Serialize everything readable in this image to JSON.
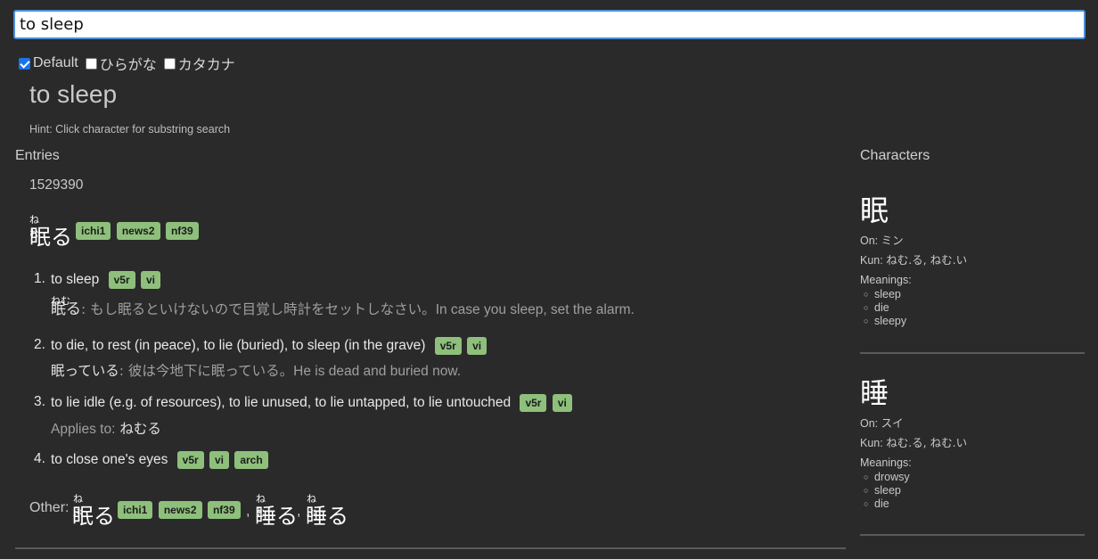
{
  "search": {
    "value": "to sleep"
  },
  "filters": [
    {
      "label": "Default",
      "checked": true
    },
    {
      "label": "ひらがな",
      "checked": false
    },
    {
      "label": "カタカナ",
      "checked": false
    }
  ],
  "query_title": "to sleep",
  "hint": "Hint: Click character for substring search",
  "entries": {
    "heading": "Entries",
    "id": "1529390",
    "headword": {
      "kanji": "眠る",
      "furigana": "ねむ",
      "tags": [
        "ichi1",
        "news2",
        "nf39"
      ]
    },
    "senses": [
      {
        "num": "1.",
        "gloss": "to sleep",
        "tags": [
          "v5r",
          "vi"
        ],
        "example": {
          "word": "眠る",
          "furigana": "ねむ",
          "sep": ":",
          "jp": "もし眠るといけないので目覚し時計をセットしなさい。",
          "en": "In case you sleep, set the alarm."
        }
      },
      {
        "num": "2.",
        "gloss": "to die, to rest (in peace), to lie (buried), to sleep (in the grave)",
        "tags": [
          "v5r",
          "vi"
        ],
        "example": {
          "word": "眠っている",
          "sep": ":",
          "jp": "彼は今地下に眠っている。",
          "en": "He is dead and buried now."
        }
      },
      {
        "num": "3.",
        "gloss": "to lie idle (e.g. of resources), to lie unused, to lie untapped, to lie untouched",
        "tags": [
          "v5r",
          "vi"
        ],
        "applies_label": "Applies to:",
        "applies_value": "ねむる"
      },
      {
        "num": "4.",
        "gloss": "to close one's eyes",
        "tags": [
          "v5r",
          "vi",
          "arch"
        ]
      }
    ],
    "other": {
      "label": "Other:",
      "forms": [
        {
          "kanji": "眠る",
          "furigana": "ねぶ",
          "tags": [
            "ichi1",
            "news2",
            "nf39"
          ]
        },
        {
          "kanji": "睡る",
          "furigana": "ねむ",
          "tags": []
        },
        {
          "kanji": "睡る",
          "furigana": "ねぶ",
          "tags": []
        }
      ],
      "sep": ","
    }
  },
  "characters": {
    "heading": "Characters",
    "items": [
      {
        "glyph": "眠",
        "on_label": "On:",
        "on": "ミン",
        "kun_label": "Kun:",
        "kun": "ねむ.る, ねむ.い",
        "meanings_label": "Meanings:",
        "meanings": [
          "sleep",
          "die",
          "sleepy"
        ]
      },
      {
        "glyph": "睡",
        "on_label": "On:",
        "on": "スイ",
        "kun_label": "Kun:",
        "kun": "ねむ.る, ねむ.い",
        "meanings_label": "Meanings:",
        "meanings": [
          "drowsy",
          "sleep",
          "die"
        ]
      }
    ]
  },
  "colors": {
    "tag_bg": "#8ec07c",
    "background": "#2a2a2a",
    "accent": "#4a90d9"
  }
}
